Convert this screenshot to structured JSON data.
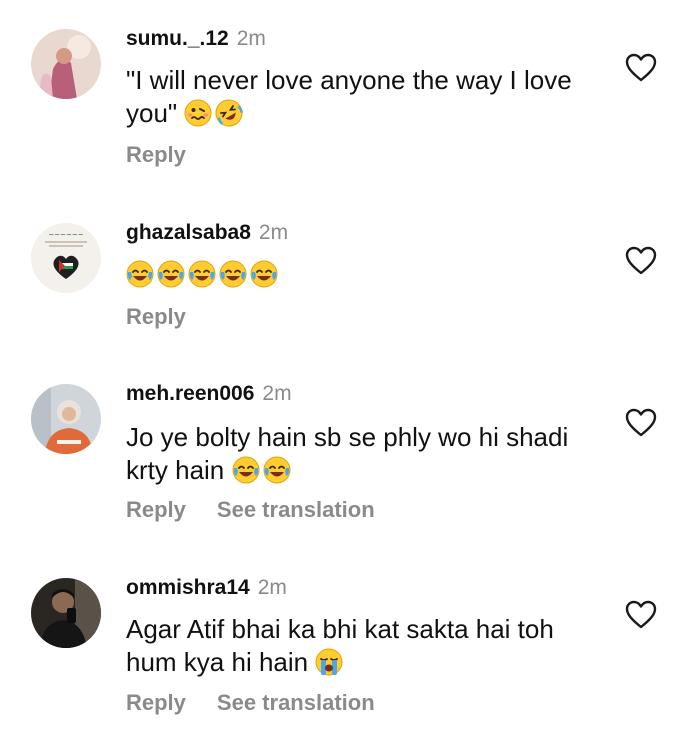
{
  "comments": [
    {
      "username": "sumu._.12",
      "time": "2m",
      "text": "\"I will never love anyone the way I love you\"",
      "emojis": [
        "woozy-face",
        "rofl"
      ],
      "reply_label": "Reply",
      "translate_label": ""
    },
    {
      "username": "ghazalsaba8",
      "time": "2m",
      "text": "",
      "emojis": [
        "joy",
        "joy",
        "joy",
        "joy",
        "joy"
      ],
      "reply_label": "Reply",
      "translate_label": ""
    },
    {
      "username": "meh.reen006",
      "time": "2m",
      "text": "Jo ye bolty hain sb se phly wo hi shadi krty hain",
      "emojis": [
        "joy",
        "joy"
      ],
      "reply_label": "Reply",
      "translate_label": "See translation"
    },
    {
      "username": "ommishra14",
      "time": "2m",
      "text": "Agar Atif bhai ka bhi kat sakta hai toh hum kya hi hain",
      "emojis": [
        "loudly-crying"
      ],
      "reply_label": "Reply",
      "translate_label": "See translation"
    }
  ],
  "colors": {
    "text": "#111111",
    "muted": "#8a8a8a",
    "emoji_yellow": "#ffcc33",
    "tear_blue": "#4aa8e8"
  }
}
